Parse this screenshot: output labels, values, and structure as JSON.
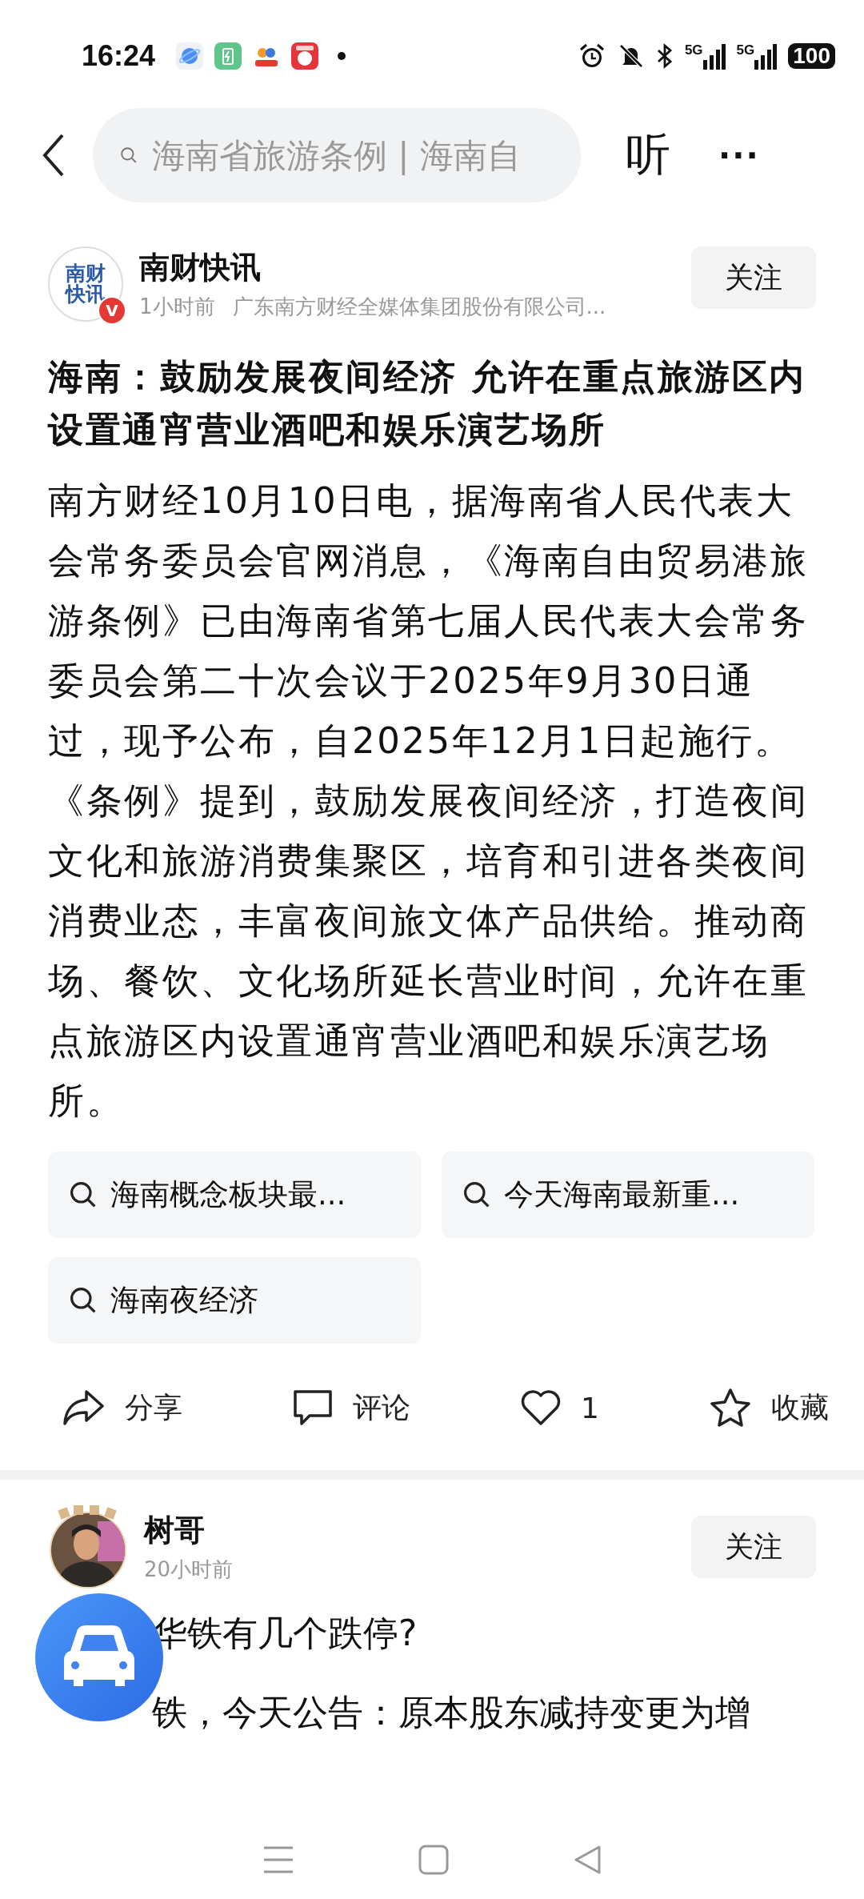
{
  "status_bar": {
    "time": "16:24",
    "network_labels": [
      "5G",
      "5G"
    ],
    "battery": "100"
  },
  "header": {
    "search": {
      "placeholder": "海南省旅游条例 | 海南自"
    },
    "listen": "听",
    "more": "···"
  },
  "article": {
    "author": {
      "name": "南财快讯",
      "logo_lines": [
        "南财",
        "快讯"
      ],
      "verified": true,
      "verified_mark": "V",
      "time": "1小时前",
      "source": "广东南方财经全媒体集团股份有限公司...",
      "follow": "关注"
    },
    "title": "海南：鼓励发展夜间经济 允许在重点旅游区内设置通宵营业酒吧和娱乐演艺场所",
    "body": "南方财经10月10日电，据海南省人民代表大会常务委员会官网消息，《海南自由贸易港旅游条例》已由海南省第七届人民代表大会常务委员会第二十次会议于2025年9月30日通过，现予公布，自2025年12月1日起施行。《条例》提到，鼓励发展夜间经济，打造夜间文化和旅游消费集聚区，培育和引进各类夜间消费业态，丰富夜间旅文体产品供给。推动商场、餐饮、文化场所延长营业时间，允许在重点旅游区内设置通宵营业酒吧和娱乐演艺场所。",
    "related_searches": [
      "海南概念板块最...",
      "今天海南最新重...",
      "海南夜经济"
    ],
    "actions": [
      {
        "kind": "share",
        "label": "分享",
        "selected": false
      },
      {
        "kind": "comment",
        "label": "评论",
        "selected": false
      },
      {
        "kind": "like",
        "label": "1",
        "selected": false
      },
      {
        "kind": "favorite",
        "label": "收藏",
        "selected": false
      }
    ]
  },
  "post": {
    "author": {
      "name": "树哥",
      "time": "20小时前",
      "follow": "关注"
    },
    "lines": [
      "华铁有几个跌停?",
      "铁，今天公告：原本股东减持变更为增"
    ]
  }
}
